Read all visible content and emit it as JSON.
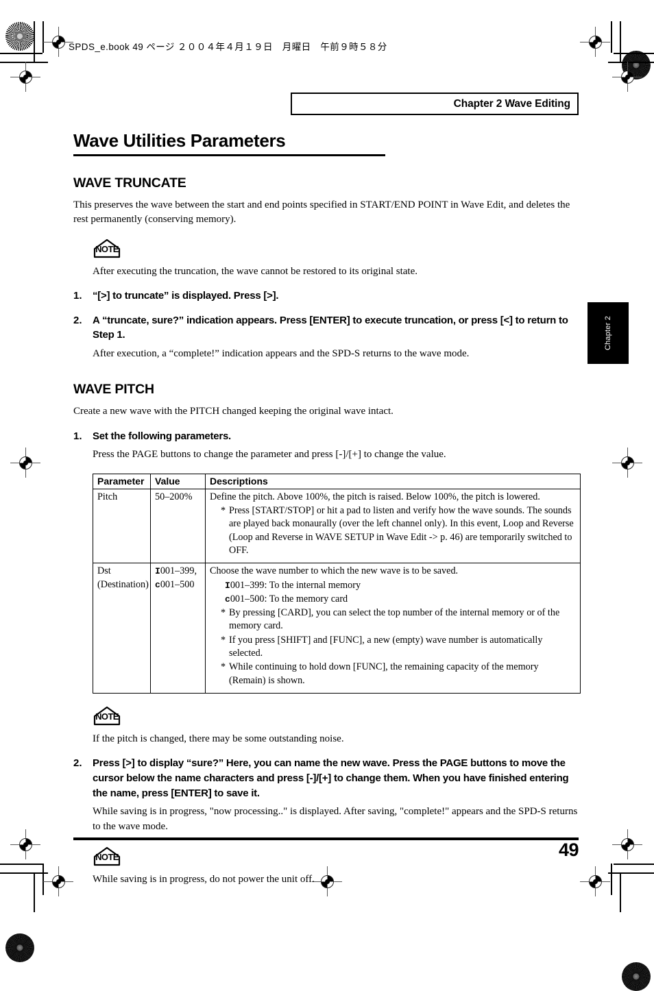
{
  "print_header": {
    "text": "SPDS_e.book 49 ページ ２００４年４月１９日　月曜日　午前９時５８分"
  },
  "chapter_banner": {
    "label": "Chapter 2 Wave Editing"
  },
  "side_tab": {
    "label": "Chapter 2"
  },
  "page_title": "Wave Utilities Parameters",
  "sections": {
    "truncate": {
      "heading": "WAVE TRUNCATE",
      "intro": "This preserves the wave between the start and end points specified in START/END POINT in Wave Edit, and deletes the rest permanently (conserving memory).",
      "note_icon_label": "NOTE",
      "note_text": "After executing the truncation, the wave cannot be restored to its original state.",
      "step1_num": "1.",
      "step1_text": "“[>] to truncate” is displayed. Press [>].",
      "step2_num": "2.",
      "step2_text": "A “truncate, sure?” indication appears. Press [ENTER] to execute truncation, or press [<] to return to Step 1.",
      "step2_sub": "After execution, a “complete!” indication appears and the SPD-S returns to the wave mode."
    },
    "pitch": {
      "heading": "WAVE PITCH",
      "intro": "Create a new wave with the PITCH changed keeping the original wave intact.",
      "step1_num": "1.",
      "step1_text": "Set the following parameters.",
      "step1_sub": "Press the PAGE buttons to change the parameter and press [-]/[+] to change the value.",
      "note_icon_label": "NOTE",
      "note_text": "If the pitch is changed, there may be some outstanding noise.",
      "step2_num": "2.",
      "step2_text": "Press [>] to display “sure?” Here, you can name the new wave. Press the PAGE buttons to move the cursor below the name characters and press [-]/[+] to change them. When you have finished entering the name, press [ENTER] to save it.",
      "step2_sub": "While saving is in progress, \"now processing..\" is displayed. After saving, \"complete!\" appears and the SPD-S returns to the wave mode.",
      "note2_icon_label": "NOTE",
      "note2_text": "While saving is in progress, do not power the unit off."
    }
  },
  "param_table": {
    "headers": [
      "Parameter",
      "Value",
      "Descriptions"
    ],
    "rows": [
      {
        "parameter": "Pitch",
        "value": "50–200%",
        "desc_lead": "Define the pitch. Above 100%, the pitch is raised. Below 100%, the pitch is lowered.",
        "desc_bullets": [
          "Press [START/STOP] or hit a pad to listen and verify how the wave sounds. The sounds are played back monaurally (over the left channel only). In this event, Loop and Reverse (Loop and Reverse in WAVE SETUP in Wave Edit -> p. 46) are temporarily switched to OFF."
        ],
        "desc_plain": []
      },
      {
        "parameter": "Dst (Destination)",
        "value_lines": [
          "I001–399,",
          "c001–500"
        ],
        "value_prefixes": [
          "I",
          "c"
        ],
        "value_rest": [
          "001–399,",
          "001–500"
        ],
        "desc_lead": "Choose the wave number to which the new wave is to be saved.",
        "desc_plain": [
          {
            "prefix": "I",
            "text": "001–399: To the internal memory"
          },
          {
            "prefix": "c",
            "text": "001–500: To the memory card"
          }
        ],
        "desc_bullets": [
          "By pressing [CARD], you can select the top number of the internal memory or of the memory card.",
          "If you press [SHIFT] and [FUNC], a new (empty) wave number is automatically selected.",
          "While continuing to hold down [FUNC], the remaining capacity of the memory (Remain) is shown."
        ]
      }
    ]
  },
  "footer": {
    "page_number": "49"
  }
}
